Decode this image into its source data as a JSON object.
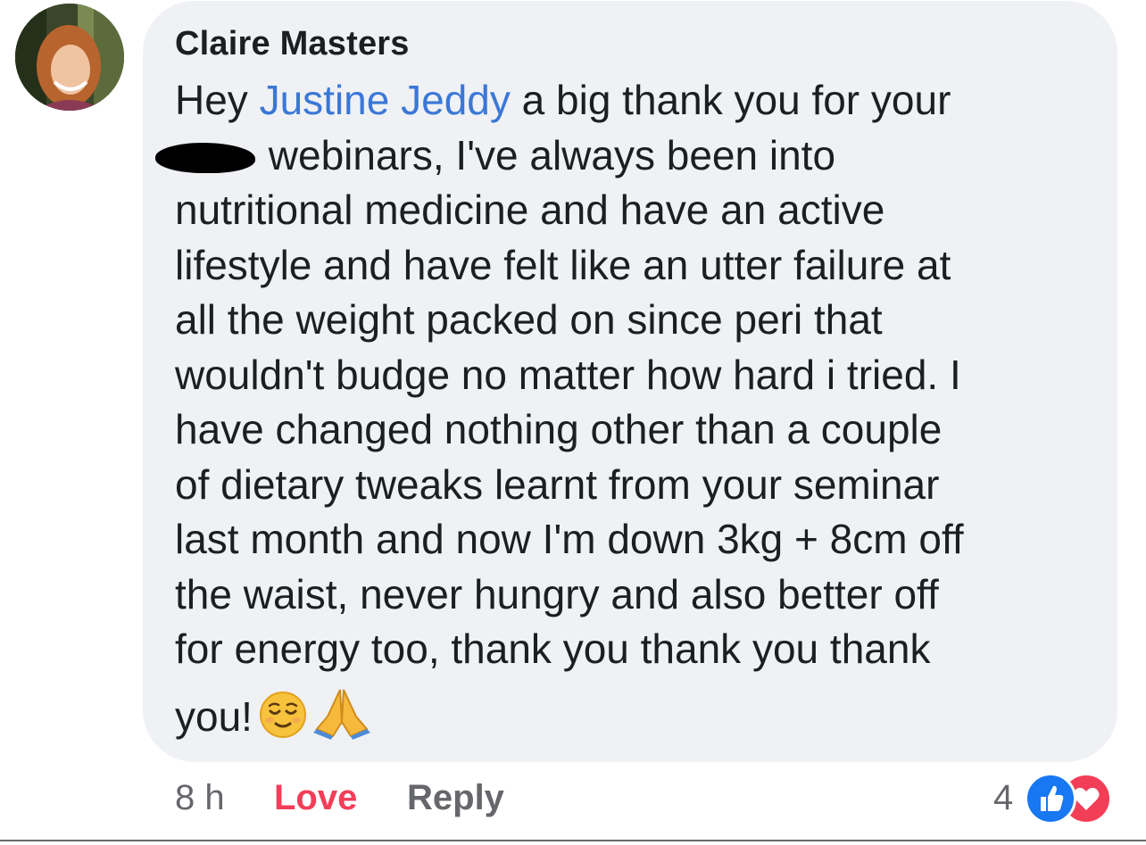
{
  "comment": {
    "author": "Claire Masters",
    "lines": [
      {
        "before": "Hey ",
        "mention": "Justine Jeddy",
        "after": " a big thank you for your"
      },
      {
        "text": "webinars, I've always been into"
      },
      {
        "text": "nutritional medicine and have an active"
      },
      {
        "text": "lifestyle and have felt like an utter failure at"
      },
      {
        "text": "all the weight packed on since peri that"
      },
      {
        "text": "wouldn't budge no matter how hard i tried. I"
      },
      {
        "text": "have changed nothing other than a couple"
      },
      {
        "text": "of dietary tweaks learnt from your seminar"
      },
      {
        "text": "last month and now I'm down 3kg + 8cm off"
      },
      {
        "text": "the waist, never hungry and also better off"
      },
      {
        "text": "for energy too, thank you thank you thank"
      },
      {
        "text": "you!"
      }
    ],
    "emojis": [
      "relieved-face-emoji",
      "folded-hands-emoji"
    ]
  },
  "actions": {
    "time": "8 h",
    "love_label": "Love",
    "reply_label": "Reply"
  },
  "reactions": {
    "count": "4",
    "icons": [
      "like-icon",
      "heart-icon"
    ]
  },
  "colors": {
    "bubble": "#eff1f4",
    "mention": "#3b77d6",
    "love": "#f33e58",
    "like": "#1877f2",
    "muted": "#65676b"
  }
}
